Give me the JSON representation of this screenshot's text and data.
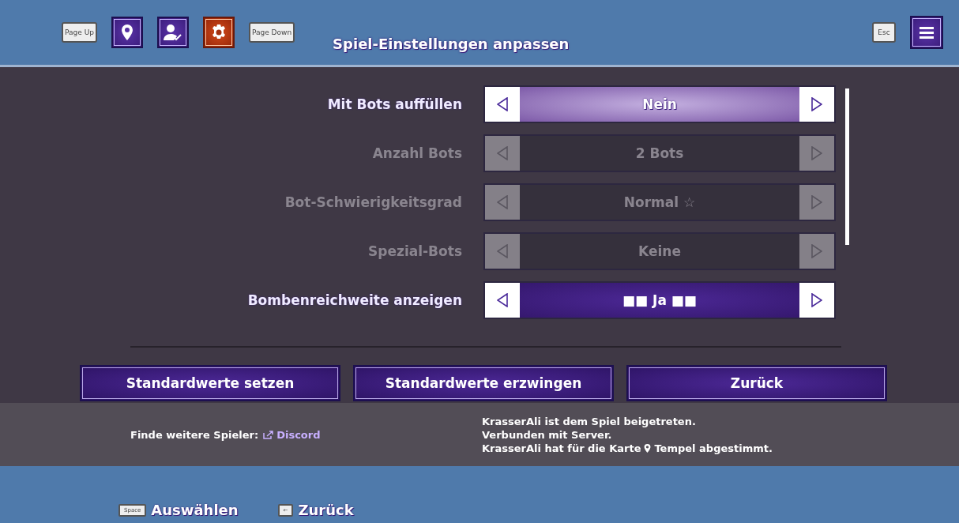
{
  "top_bar": {
    "prev_key": "Page Up",
    "tabs": [
      {
        "selected": false
      },
      {
        "selected": false
      },
      {
        "selected": true
      }
    ],
    "next_key": "Page Down",
    "title": "Spiel-Einstellungen anpassen",
    "esc_key": "Esc"
  },
  "settings": [
    {
      "label": "Mit Bots auffüllen",
      "value": "Nein",
      "disabled": false,
      "selected": true
    },
    {
      "label": "Anzahl Bots",
      "value": "2 Bots",
      "disabled": true,
      "selected": false
    },
    {
      "label": "Bot-Schwierigkeitsgrad",
      "value": "Normal ☆",
      "disabled": true,
      "selected": false
    },
    {
      "label": "Spezial-Bots",
      "value": "Keine",
      "disabled": true,
      "selected": false
    },
    {
      "label": "Bombenreichweite anzeigen",
      "value": "■■ Ja ■■",
      "disabled": false,
      "selected": false
    }
  ],
  "buttons": [
    "Standardwerte setzen",
    "Standardwerte erzwingen",
    "Zurück"
  ],
  "footer": {
    "find_label": "Finde weitere Spieler:",
    "discord_link": "Discord",
    "log": [
      "KrasserAli ist dem Spiel beigetreten.",
      "Verbunden mit Server.",
      "KrasserAli hat für die Karte",
      "Tempel abgestimmt."
    ]
  },
  "hints": [
    {
      "key": "Space",
      "label": "Auswählen"
    },
    {
      "key": "←",
      "label": "Zurück"
    }
  ]
}
